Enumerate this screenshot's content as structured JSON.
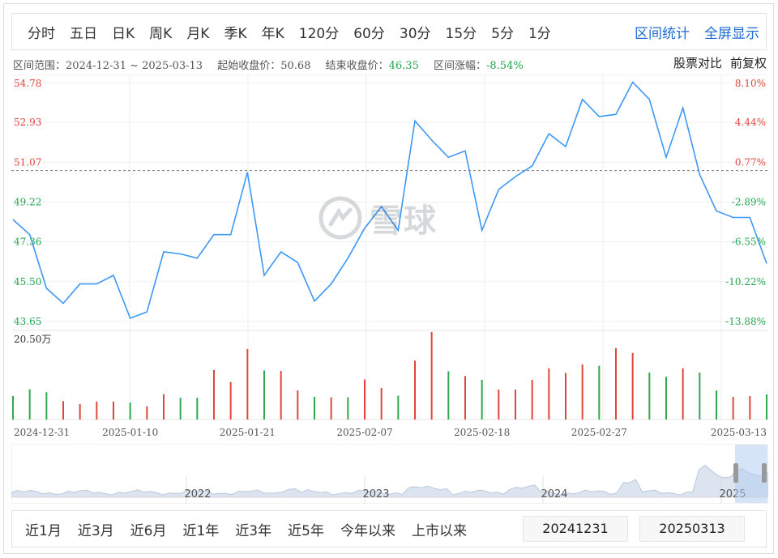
{
  "period_tabs": [
    "分时",
    "五日",
    "日K",
    "周K",
    "月K",
    "季K",
    "年K",
    "120分",
    "60分",
    "30分",
    "15分",
    "5分",
    "1分"
  ],
  "top_links": {
    "range_stats": "区间统计",
    "fullscreen": "全屏显示"
  },
  "info": {
    "range_label": "区间范围：",
    "range_value": "2024-12-31 ~ 2025-03-13",
    "start_label": "起始收盘价：",
    "start_value": "50.68",
    "end_label": "结束收盘价：",
    "end_value": "46.35",
    "change_label": "区间涨幅：",
    "change_value": "-8.54%",
    "compare": "股票对比",
    "adjust": "前复权"
  },
  "colors": {
    "line": "#3d97f5",
    "up": "#e0463c",
    "down": "#2fa84f",
    "ref_red": "#e0463c",
    "ref_green": "#23a64f",
    "link": "#1e6bd6"
  },
  "chart_data": {
    "type": "line",
    "y_ticks": [
      "54.78",
      "52.93",
      "51.07",
      "49.22",
      "47.36",
      "45.50",
      "43.65"
    ],
    "pct_ticks": [
      "8.10%",
      "4.44%",
      "0.77%",
      "-2.89%",
      "-6.55%",
      "-10.22%",
      "-13.88%"
    ],
    "ylim": [
      43.65,
      54.78
    ],
    "reference_price": 50.68,
    "x_tick_labels": [
      "2024-12-31",
      "2025-01-10",
      "2025-01-21",
      "2025-02-07",
      "2025-02-18",
      "2025-02-27",
      "2025-03-13"
    ],
    "x_tick_index": [
      0,
      7,
      14,
      21,
      28,
      35,
      45
    ],
    "close": [
      48.4,
      47.7,
      45.2,
      44.5,
      45.4,
      45.4,
      45.8,
      43.8,
      44.1,
      46.9,
      46.8,
      46.6,
      47.7,
      47.7,
      50.6,
      45.8,
      46.9,
      46.4,
      44.6,
      45.4,
      46.6,
      48.0,
      49.0,
      47.9,
      53.0,
      52.1,
      51.3,
      51.6,
      47.9,
      49.8,
      50.4,
      50.9,
      52.4,
      51.8,
      54.0,
      53.2,
      53.3,
      54.8,
      54.0,
      51.3,
      53.6,
      50.5,
      48.8,
      48.5,
      48.5,
      46.35
    ],
    "volume_max_label": "20.50万",
    "volume_max": 20.5,
    "volume": [
      5.5,
      7.1,
      6.4,
      4.3,
      3.6,
      4.2,
      4.2,
      4.0,
      3.1,
      5.9,
      5.1,
      5.1,
      11.6,
      8.8,
      16.5,
      11.5,
      11.4,
      6.8,
      5.3,
      5.2,
      5.2,
      9.4,
      7.4,
      5.6,
      13.8,
      20.5,
      11.3,
      10.2,
      9.3,
      7.0,
      7.0,
      9.3,
      12.0,
      10.9,
      12.9,
      12.6,
      16.7,
      15.6,
      11.0,
      10.0,
      12.0,
      11.0,
      6.8,
      5.3,
      5.5,
      5.9
    ],
    "volume_dir": [
      "down",
      "down",
      "down",
      "up",
      "up",
      "up",
      "up",
      "down",
      "up",
      "up",
      "down",
      "down",
      "up",
      "up",
      "up",
      "down",
      "up",
      "up",
      "down",
      "up",
      "down",
      "up",
      "up",
      "down",
      "up",
      "up",
      "down",
      "up",
      "down",
      "up",
      "up",
      "up",
      "up",
      "up",
      "up",
      "down",
      "up",
      "up",
      "down",
      "down",
      "up",
      "down",
      "down",
      "up",
      "up",
      "down"
    ],
    "mini_year_labels": [
      "2022",
      "2023",
      "2024",
      "2025"
    ]
  },
  "range_tabs": [
    "近1月",
    "近3月",
    "近6月",
    "近1年",
    "近3年",
    "近5年",
    "今年以来",
    "上市以来"
  ],
  "date_inputs": {
    "start": "20241231",
    "end": "20250313"
  },
  "watermark": "雪球"
}
